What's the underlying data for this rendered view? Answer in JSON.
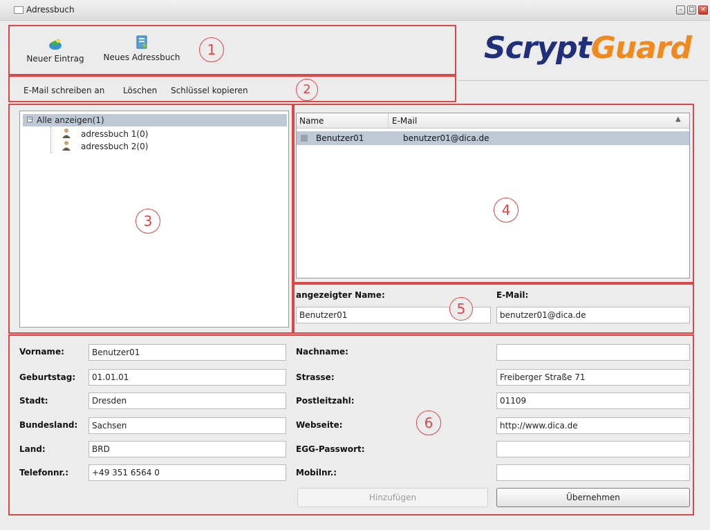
{
  "window": {
    "title": "Adressbuch"
  },
  "annotations": [
    "1",
    "2",
    "3",
    "4",
    "5",
    "6"
  ],
  "toolbar": {
    "new_entry": "Neuer Eintrag",
    "new_addressbook": "Neues Adressbuch"
  },
  "logo": {
    "part1": "Scrypt",
    "part2": "Guard",
    "color1": "#1f2f7a",
    "color2": "#f08a1e"
  },
  "menu": {
    "write_mail": "E-Mail schreiben an",
    "delete": "Löschen",
    "copy_key": "Schlüssel kopieren"
  },
  "tree": {
    "root": "Alle anzeigen(1)",
    "items": [
      "adressbuch 1(0)",
      "adressbuch 2(0)"
    ]
  },
  "contacts": {
    "col_name": "Name",
    "col_email": "E-Mail",
    "rows": [
      {
        "name": "Benutzer01",
        "email": "benutzer01@dica.de"
      }
    ]
  },
  "summary": {
    "display_name_label": "angezeigter Name:",
    "email_label": "E-Mail:",
    "display_name_value": "Benutzer01",
    "email_value": "benutzer01@dica.de"
  },
  "details": {
    "left": [
      {
        "label": "Vorname:",
        "value": "Benutzer01"
      },
      {
        "label": "Geburtstag:",
        "value": "01.01.01"
      },
      {
        "label": "Stadt:",
        "value": "Dresden"
      },
      {
        "label": "Bundesland:",
        "value": "Sachsen"
      },
      {
        "label": "Land:",
        "value": "BRD"
      },
      {
        "label": "Telefonnr.:",
        "value": "+49 351 6564 0"
      }
    ],
    "right": [
      {
        "label": "Nachname:",
        "value": ""
      },
      {
        "label": "Strasse:",
        "value": "Freiberger Straße 71"
      },
      {
        "label": "Postleitzahl:",
        "value": "01109"
      },
      {
        "label": "Webseite:",
        "value": "http://www.dica.de"
      },
      {
        "label": "EGG-Passwort:",
        "value": ""
      },
      {
        "label": "Mobilnr.:",
        "value": ""
      }
    ],
    "add_button": "Hinzufügen",
    "apply_button": "Übernehmen"
  }
}
